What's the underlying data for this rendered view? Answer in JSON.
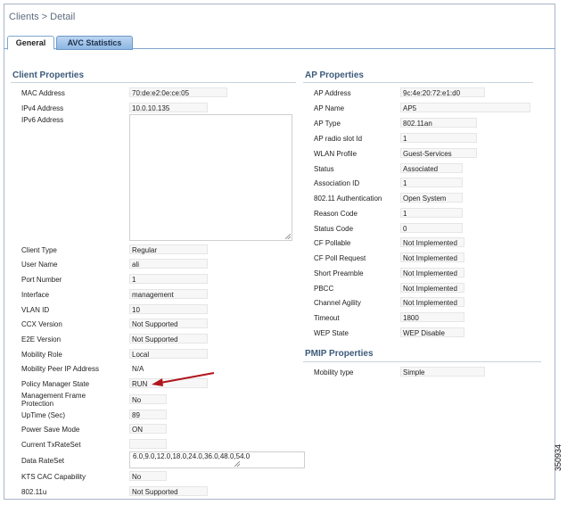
{
  "breadcrumb": "Clients > Detail",
  "tabs": [
    {
      "label": "General",
      "active": true
    },
    {
      "label": "AVC Statistics",
      "active": false
    }
  ],
  "client_properties": {
    "title": "Client Properties",
    "rows": [
      {
        "label": "MAC Address",
        "value": "70:de:e2:0e:ce:05"
      },
      {
        "label": "IPv4 Address",
        "value": "10.0.10.135"
      },
      {
        "label": "IPv6 Address",
        "value": ""
      },
      {
        "label": "Client Type",
        "value": "Regular"
      },
      {
        "label": "User Name",
        "value": "ali"
      },
      {
        "label": "Port Number",
        "value": "1"
      },
      {
        "label": "Interface",
        "value": "management"
      },
      {
        "label": "VLAN ID",
        "value": "10"
      },
      {
        "label": "CCX Version",
        "value": "Not Supported"
      },
      {
        "label": "E2E Version",
        "value": "Not Supported"
      },
      {
        "label": "Mobility Role",
        "value": "Local"
      },
      {
        "label": "Mobility Peer IP Address",
        "value": "N/A"
      },
      {
        "label": "Policy Manager State",
        "value": "RUN"
      },
      {
        "label": "Management Frame Protection",
        "value": "No"
      },
      {
        "label": "UpTime (Sec)",
        "value": "89"
      },
      {
        "label": "Power Save Mode",
        "value": "ON"
      },
      {
        "label": "Current TxRateSet",
        "value": ""
      },
      {
        "label": "Data RateSet",
        "value": "6.0,9.0,12.0,18.0,24.0,36.0,48.0,54.0"
      },
      {
        "label": "KTS CAC Capability",
        "value": "No"
      },
      {
        "label": "802.11u",
        "value": "Not Supported"
      }
    ]
  },
  "ap_properties": {
    "title": "AP Properties",
    "rows": [
      {
        "label": "AP Address",
        "value": "9c:4e:20:72:e1:d0"
      },
      {
        "label": "AP Name",
        "value": "AP5"
      },
      {
        "label": "AP Type",
        "value": "802.11an"
      },
      {
        "label": "AP radio slot Id",
        "value": "1"
      },
      {
        "label": "WLAN Profile",
        "value": "Guest-Services"
      },
      {
        "label": "Status",
        "value": "Associated"
      },
      {
        "label": "Association ID",
        "value": "1"
      },
      {
        "label": "802.11 Authentication",
        "value": "Open System"
      },
      {
        "label": "Reason Code",
        "value": "1"
      },
      {
        "label": "Status Code",
        "value": "0"
      },
      {
        "label": "CF Pollable",
        "value": "Not Implemented"
      },
      {
        "label": "CF Poll Request",
        "value": "Not Implemented"
      },
      {
        "label": "Short Preamble",
        "value": "Not Implemented"
      },
      {
        "label": "PBCC",
        "value": "Not Implemented"
      },
      {
        "label": "Channel Agility",
        "value": "Not Implemented"
      },
      {
        "label": "Timeout",
        "value": "1800"
      },
      {
        "label": "WEP State",
        "value": "WEP Disable"
      }
    ]
  },
  "pmip_properties": {
    "title": "PMIP Properties",
    "rows": [
      {
        "label": "Mobility type",
        "value": "Simple"
      }
    ]
  },
  "figure_id": "350934",
  "colors": {
    "section_title": "#3c5a7a",
    "tab_active_border": "#7fa6cf",
    "annotation_arrow": "#b0161c"
  }
}
